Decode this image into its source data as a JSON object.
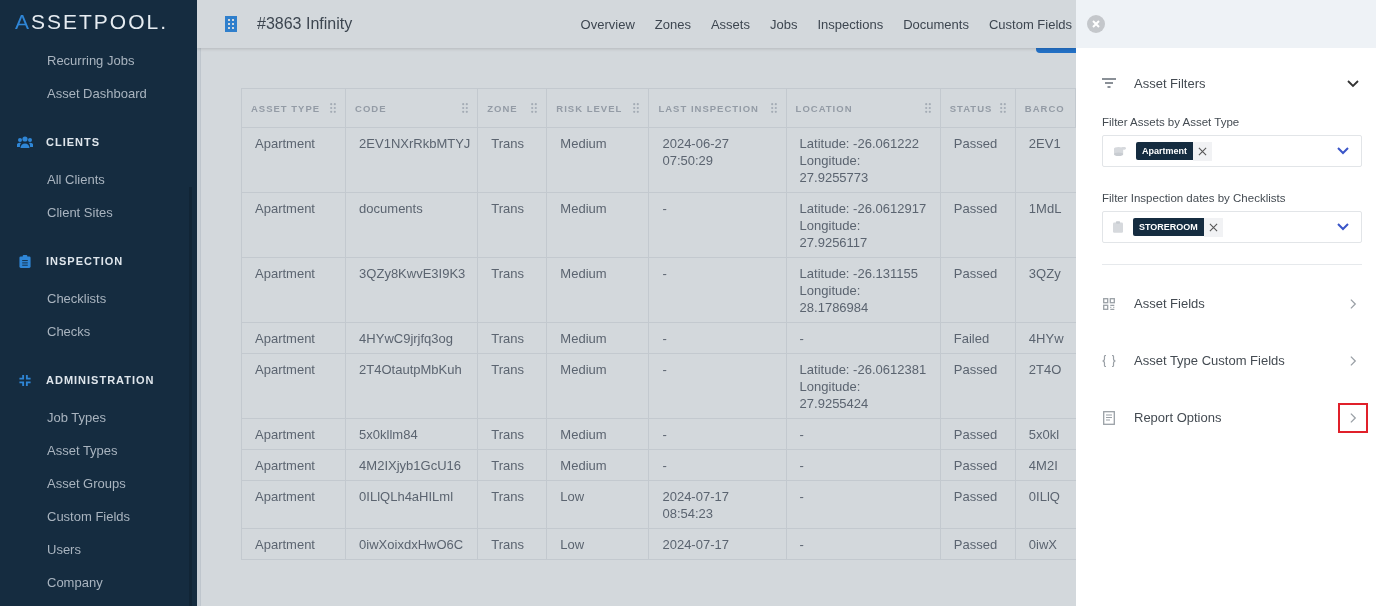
{
  "logo": "ASSETPOOL.",
  "sidebar": {
    "items": [
      {
        "label": "Recurring Jobs"
      },
      {
        "label": "Asset Dashboard"
      }
    ],
    "sections": [
      {
        "kind": "people",
        "title": "CLIENTS",
        "items": [
          {
            "label": "All Clients"
          },
          {
            "label": "Client Sites"
          }
        ]
      },
      {
        "kind": "clipboard",
        "title": "INSPECTION",
        "items": [
          {
            "label": "Checklists"
          },
          {
            "label": "Checks"
          }
        ]
      },
      {
        "kind": "compress",
        "title": "ADMINISTRATION",
        "items": [
          {
            "label": "Job Types"
          },
          {
            "label": "Asset Types"
          },
          {
            "label": "Asset Groups"
          },
          {
            "label": "Custom Fields"
          },
          {
            "label": "Users"
          },
          {
            "label": "Company"
          }
        ]
      }
    ]
  },
  "header": {
    "title": "#3863 Infinity",
    "nav": [
      "Overview",
      "Zones",
      "Assets",
      "Jobs",
      "Inspections",
      "Documents",
      "Custom Fields"
    ]
  },
  "table": {
    "columns": [
      "ASSET TYPE",
      "CODE",
      "ZONE",
      "RISK LEVEL",
      "LAST INSPECTION",
      "LOCATION",
      "STATUS",
      "BARCO"
    ],
    "rows": [
      [
        "Apartment",
        "2EV1NXrRkbMTYJ",
        "Trans",
        "Medium",
        "2024-06-27\n07:50:29",
        "Latitude: -26.061222\nLongitude:\n27.9255773",
        "Passed",
        "2EV1"
      ],
      [
        "Apartment",
        "documents",
        "Trans",
        "Medium",
        "-",
        "Latitude: -26.0612917\nLongitude:\n27.9256117",
        "Passed",
        "1MdL"
      ],
      [
        "Apartment",
        "3QZy8KwvE3I9K3",
        "Trans",
        "Medium",
        "-",
        "Latitude: -26.131155\nLongitude:\n28.1786984",
        "Passed",
        "3QZy"
      ],
      [
        "Apartment",
        "4HYwC9jrjfq3og",
        "Trans",
        "Medium",
        "-",
        "-",
        "Failed",
        "4HYw"
      ],
      [
        "Apartment",
        "2T4OtautpMbKuh",
        "Trans",
        "Medium",
        "-",
        "Latitude: -26.0612381\nLongitude:\n27.9255424",
        "Passed",
        "2T4O"
      ],
      [
        "Apartment",
        "5x0kllm84",
        "Trans",
        "Medium",
        "-",
        "-",
        "Passed",
        "5x0kl"
      ],
      [
        "Apartment",
        "4M2IXjyb1GcU16",
        "Trans",
        "Medium",
        "-",
        "-",
        "Passed",
        "4M2I"
      ],
      [
        "Apartment",
        "0ILlQLh4aHILml",
        "Trans",
        "Low",
        "2024-07-17\n08:54:23",
        "-",
        "Passed",
        "0ILlQ"
      ],
      [
        "Apartment",
        "0iwXoixdxHwO6C",
        "Trans",
        "Low",
        "2024-07-17",
        "-",
        "Passed",
        "0iwX"
      ]
    ]
  },
  "panel": {
    "filters": {
      "title": "Asset Filters",
      "expanded": true,
      "fields": [
        {
          "kind": "stack",
          "label": "Filter Assets by Asset Type",
          "chips": [
            "Apartment"
          ]
        },
        {
          "kind": "clipboard",
          "label": "Filter Inspection dates by Checklists",
          "chips": [
            "STOREROOM"
          ]
        }
      ]
    },
    "sections": [
      {
        "kind": "grid",
        "title": "Asset Fields",
        "highlighted": false
      },
      {
        "kind": "braces",
        "title": "Asset Type Custom Fields",
        "highlighted": false
      },
      {
        "kind": "document",
        "title": "Report Options",
        "highlighted": true
      }
    ]
  }
}
